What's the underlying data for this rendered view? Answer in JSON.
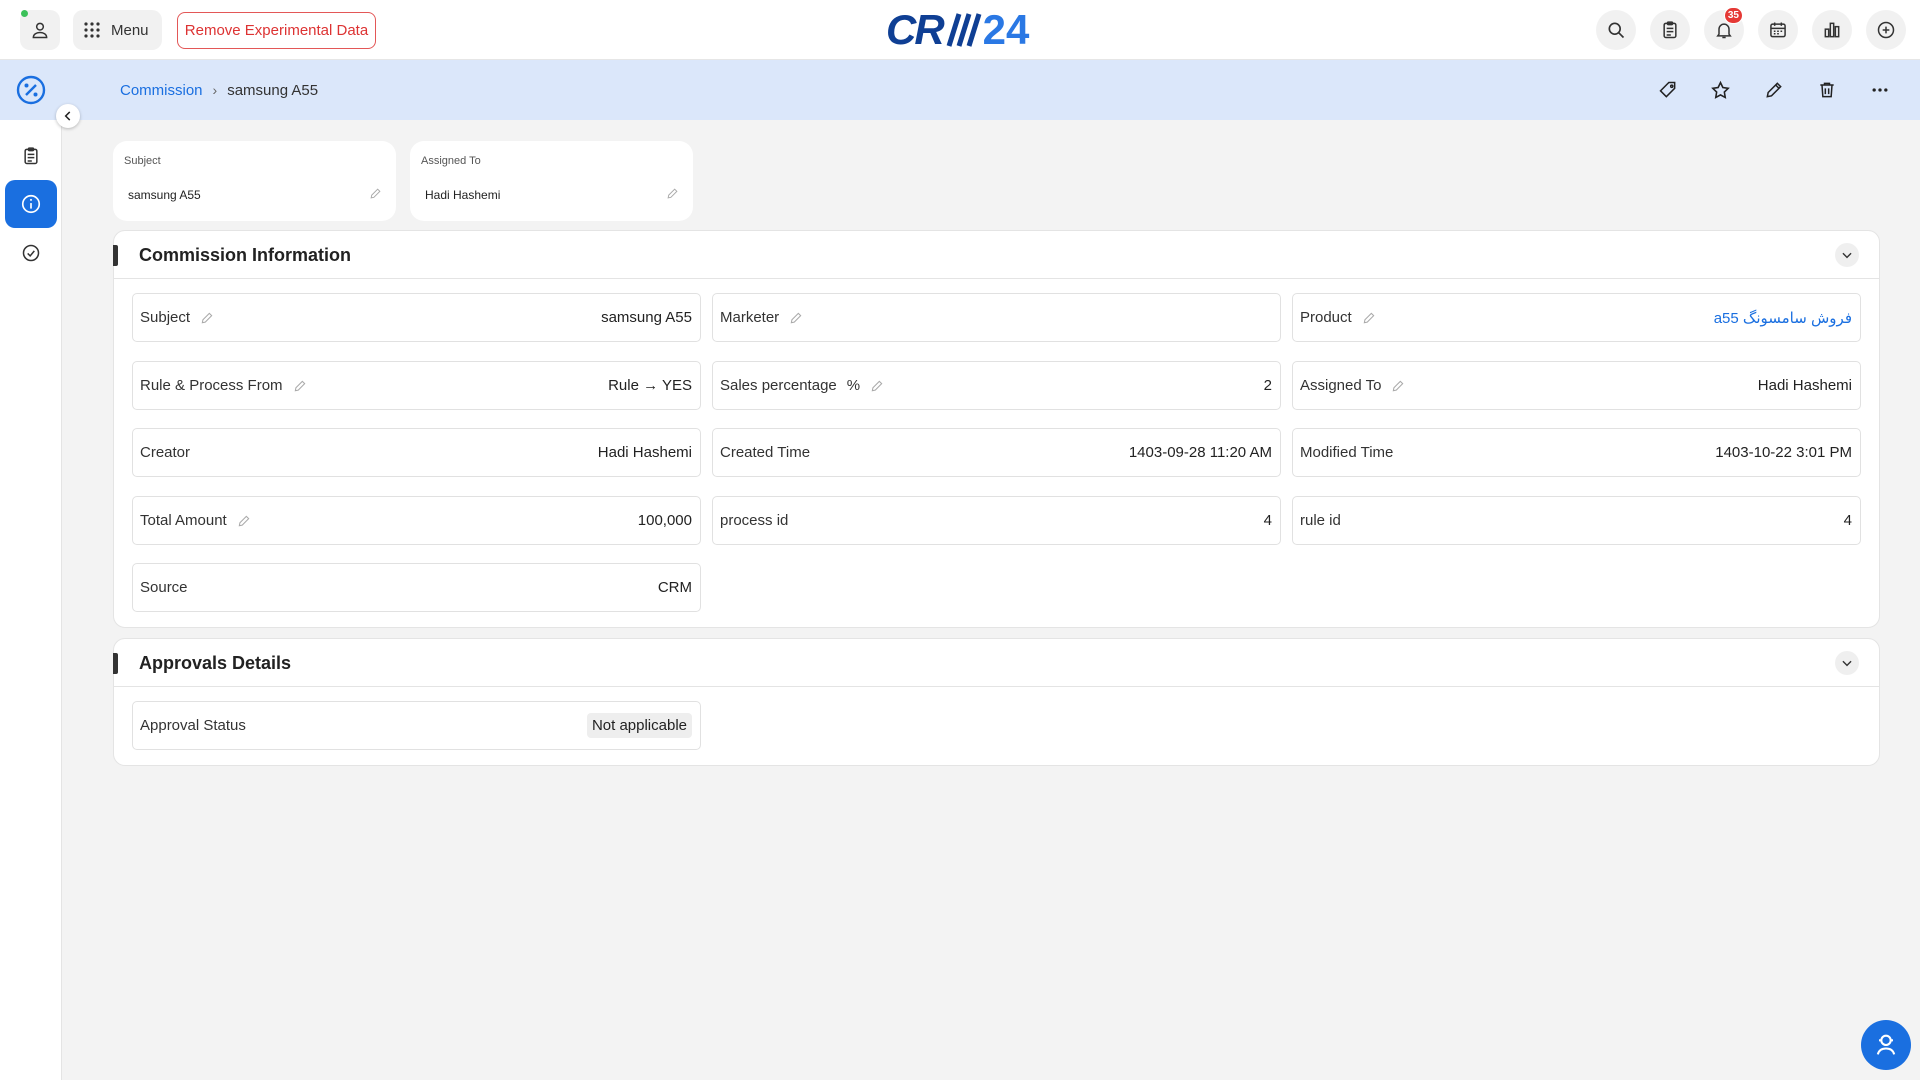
{
  "header": {
    "menu_label": "Menu",
    "remove_label": "Remove Experimental Data",
    "logo_text_a": "CR",
    "logo_text_b": "24",
    "notification_count": "35",
    "icons": [
      "search-icon",
      "clipboard-icon",
      "bell-icon",
      "calendar-icon",
      "chart-icon",
      "plus-circle-icon"
    ]
  },
  "breadcrumb": {
    "parent": "Commission",
    "separator": "›",
    "current": "samsung A55"
  },
  "summary": [
    {
      "label": "Subject",
      "value": "samsung A55"
    },
    {
      "label": "Assigned To",
      "value": "Hadi Hashemi"
    }
  ],
  "commission": {
    "title": "Commission Information",
    "fields": {
      "subject": {
        "label": "Subject",
        "value": "samsung A55"
      },
      "marketer": {
        "label": "Marketer",
        "value": ""
      },
      "product": {
        "label": "Product",
        "value": "a55 فروش سامسونگ"
      },
      "rule": {
        "label": "Rule & Process From",
        "value": "Rule → YES"
      },
      "sales": {
        "label": "Sales percentage",
        "unit": "%",
        "value": "2"
      },
      "assigned": {
        "label": "Assigned To",
        "value": "Hadi Hashemi"
      },
      "creator": {
        "label": "Creator",
        "value": "Hadi Hashemi"
      },
      "created": {
        "label": "Created Time",
        "value": "1403-09-28 11:20 AM"
      },
      "modified": {
        "label": "Modified Time",
        "value": "1403-10-22 3:01 PM"
      },
      "total": {
        "label": "Total Amount",
        "value": "100,000"
      },
      "process": {
        "label": "process id",
        "value": "4"
      },
      "ruleid": {
        "label": "rule id",
        "value": "4"
      },
      "source": {
        "label": "Source",
        "value": "CRM"
      }
    }
  },
  "approvals": {
    "title": "Approvals Details",
    "status_label": "Approval Status",
    "status_value": "Not applicable"
  },
  "colors": {
    "accent": "#1a6fe0",
    "crumb_bar": "#dbe7fa",
    "danger": "#e35757",
    "online": "#3cc15a"
  }
}
